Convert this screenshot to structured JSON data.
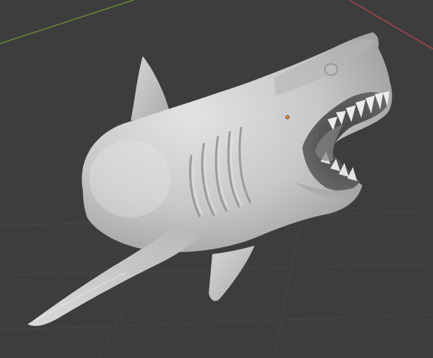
{
  "viewport": {
    "background": "#3d3d3d",
    "grid_color": "#4a4a4a",
    "x_axis_color": "#c5484f",
    "y_axis_color": "#6f9a3a",
    "origin_color": "#e8822a"
  },
  "model": {
    "subject": "shark",
    "shading": "solid",
    "base_color": "#c9c9c9",
    "shadow_color": "#8e8e8e",
    "highlight_color": "#e6e6e6",
    "mouth_color": "#5e5e5e",
    "teeth_color": "#ececec"
  },
  "icons": {
    "origin": "origin-dot-icon"
  }
}
